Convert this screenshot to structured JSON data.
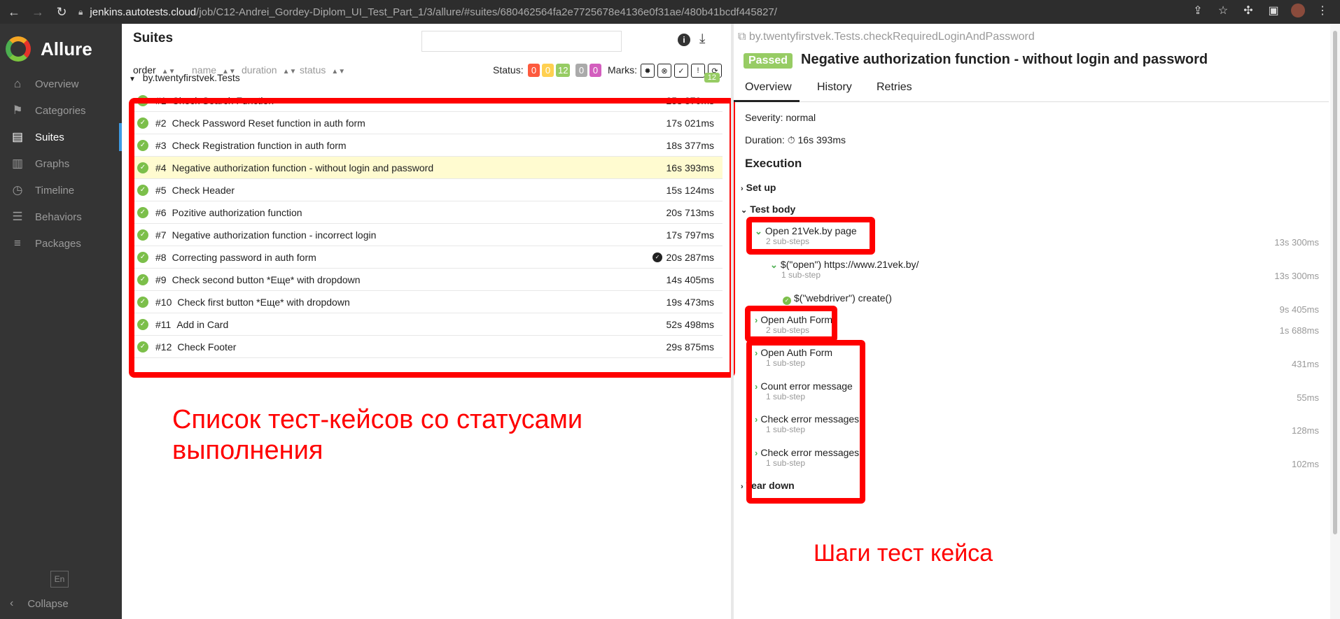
{
  "browser": {
    "url_host": "jenkins.autotests.cloud",
    "url_path": "/job/C12-Andrei_Gordey-Diplom_UI_Test_Part_1/3/allure/#suites/680462564fa2e7725678e4136e0f31ae/480b41bcdf445827/"
  },
  "app": {
    "name": "Allure"
  },
  "sidebar": {
    "items": [
      {
        "label": "Overview",
        "icon": "home-icon"
      },
      {
        "label": "Categories",
        "icon": "flag-icon"
      },
      {
        "label": "Suites",
        "icon": "briefcase-icon"
      },
      {
        "label": "Graphs",
        "icon": "bar-chart-icon"
      },
      {
        "label": "Timeline",
        "icon": "clock-icon"
      },
      {
        "label": "Behaviors",
        "icon": "list-icon"
      },
      {
        "label": "Packages",
        "icon": "align-left-icon"
      }
    ],
    "active": "Suites",
    "lang": "En",
    "collapse": "Collapse"
  },
  "suites": {
    "title": "Suites",
    "sort": {
      "order": "order",
      "name": "name",
      "duration": "duration",
      "status": "status"
    },
    "status_label": "Status:",
    "status_counts": [
      {
        "value": "0",
        "color": "#fd5a3e"
      },
      {
        "value": "0",
        "color": "#ffd050"
      },
      {
        "value": "12",
        "color": "#97cc64"
      },
      {
        "value": "0",
        "color": "#aaaaaa"
      },
      {
        "value": "0",
        "color": "#d35ebe"
      }
    ],
    "marks_label": "Marks:",
    "group": {
      "name": "by.twentyfirstvek.Tests",
      "count": "12"
    },
    "tests": [
      {
        "num": "#1",
        "name": "Check Search Function",
        "duration": "25s 870ms"
      },
      {
        "num": "#2",
        "name": "Check Password Reset function in auth form",
        "duration": "17s 021ms"
      },
      {
        "num": "#3",
        "name": "Check Registration function in auth form",
        "duration": "18s 377ms"
      },
      {
        "num": "#4",
        "name": "Negative authorization function - without login and password",
        "duration": "16s 393ms"
      },
      {
        "num": "#5",
        "name": "Check Header",
        "duration": "15s 124ms"
      },
      {
        "num": "#6",
        "name": "Pozitive authorization function",
        "duration": "20s 713ms"
      },
      {
        "num": "#7",
        "name": "Negative authorization function - incorrect login",
        "duration": "17s 797ms"
      },
      {
        "num": "#8",
        "name": "Correcting password in auth form",
        "duration": "20s 287ms"
      },
      {
        "num": "#9",
        "name": "Check second button *Еще* with dropdown",
        "duration": "14s 405ms"
      },
      {
        "num": "#10",
        "name": "Check first button *Еще* with dropdown",
        "duration": "19s 473ms"
      },
      {
        "num": "#11",
        "name": "Add in Card",
        "duration": "52s 498ms"
      },
      {
        "num": "#12",
        "name": "Check Footer",
        "duration": "29s 875ms"
      }
    ],
    "annotation": "Список тест-кейсов со статусами выполнения"
  },
  "detail": {
    "path": "by.twentyfirstvek.Tests.checkRequiredLoginAndPassword",
    "status": "Passed",
    "title": "Negative authorization function - without login and password",
    "tabs": [
      "Overview",
      "History",
      "Retries"
    ],
    "severity": "Severity: normal",
    "duration": "Duration: ⏱ 16s 393ms",
    "execution": "Execution",
    "setup": "Set up",
    "body": "Test body",
    "teardown": "Tear down",
    "steps": [
      {
        "name": "Open 21Vek.by page",
        "sub": "2 sub-steps",
        "duration": "13s 300ms"
      },
      {
        "name": "$(\"open\") https://www.21vek.by/",
        "sub": "1 sub-step",
        "duration": "13s 300ms"
      },
      {
        "name": "$(\"webdriver\") create()",
        "sub": "",
        "duration": "9s 405ms"
      },
      {
        "name": "Open Auth Form",
        "sub": "2 sub-steps",
        "duration": "1s 688ms"
      },
      {
        "name": "Open Auth Form",
        "sub": "1 sub-step",
        "duration": "431ms"
      },
      {
        "name": "Count error message",
        "sub": "1 sub-step",
        "duration": "55ms"
      },
      {
        "name": "Check error messages",
        "sub": "1 sub-step",
        "duration": "128ms"
      },
      {
        "name": "Check error messages",
        "sub": "1 sub-step",
        "duration": "102ms"
      }
    ],
    "annotation": "Шаги тест кейса"
  }
}
